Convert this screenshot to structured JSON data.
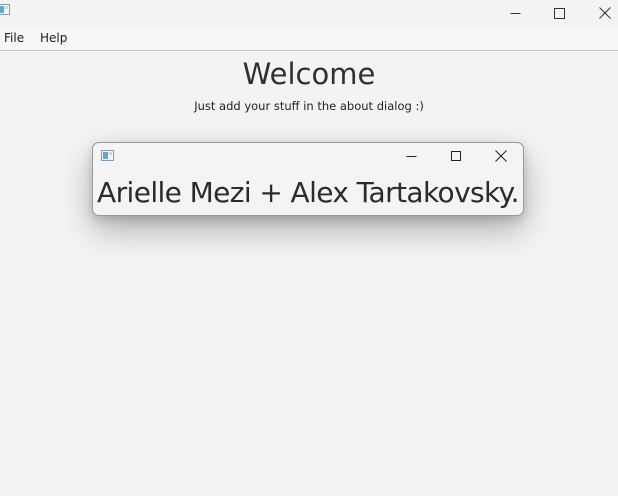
{
  "window": {
    "icon": "app-icon",
    "controls": {
      "minimize_icon": "minimize-icon",
      "maximize_icon": "maximize-icon",
      "close_icon": "close-icon"
    }
  },
  "menubar": {
    "items": [
      {
        "label": "File"
      },
      {
        "label": "Help"
      }
    ]
  },
  "main": {
    "title": "Welcome",
    "subtitle": "Just add your stuff in the about dialog :)"
  },
  "about_dialog": {
    "icon": "app-icon",
    "text": "Arielle Mezi + Alex Tartakovsky.",
    "controls": {
      "minimize_icon": "minimize-icon",
      "maximize_icon": "maximize-icon",
      "close_icon": "close-icon"
    }
  }
}
